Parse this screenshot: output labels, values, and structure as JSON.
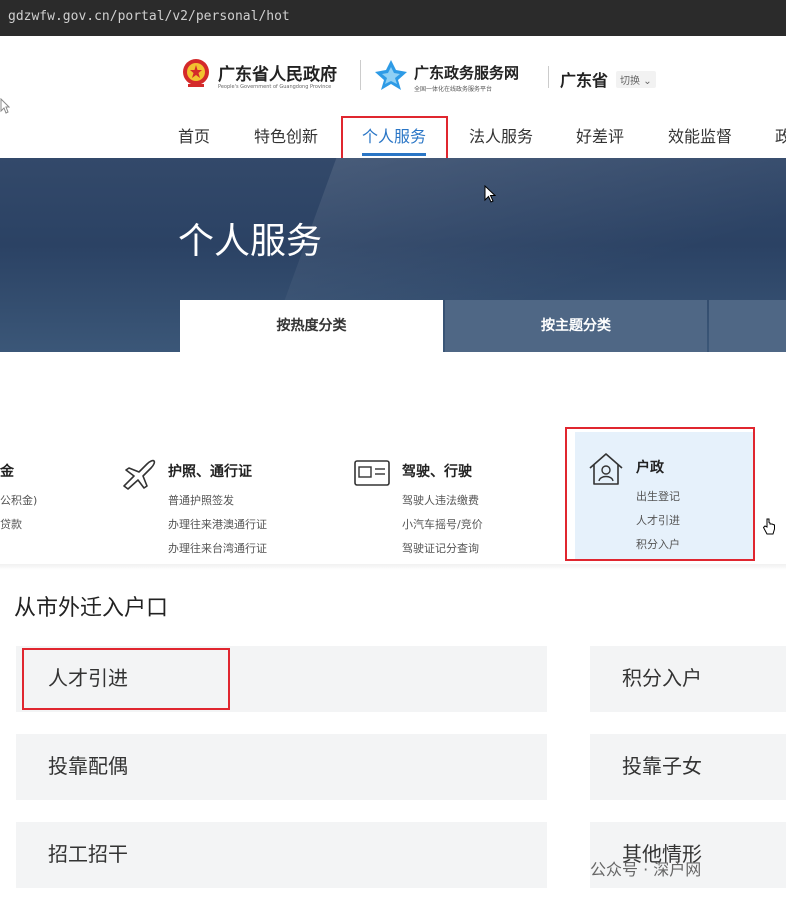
{
  "browser": {
    "url": "gdzwfw.gov.cn/portal/v2/personal/hot"
  },
  "header": {
    "gov_name_cn": "广东省人民政府",
    "gov_name_en": "People's Government of Guangdong Province",
    "service_name": "广东政务服务网",
    "service_subtitle": "全国一体化在线政务服务平台",
    "province": "广东省",
    "switch_label": "切换"
  },
  "nav": {
    "items": [
      "首页",
      "特色创新",
      "个人服务",
      "法人服务",
      "好差评",
      "效能监督",
      "政"
    ],
    "active": "个人服务"
  },
  "banner": {
    "title": "个人服务",
    "tabs": [
      "按热度分类",
      "按主题分类"
    ]
  },
  "categories": [
    {
      "title": "金",
      "items": [
        "公积金)",
        "贷款"
      ]
    },
    {
      "title": "护照、通行证",
      "items": [
        "普通护照签发",
        "办理往来港澳通行证",
        "办理往来台湾通行证"
      ]
    },
    {
      "title": "驾驶、行驶",
      "items": [
        "驾驶人违法缴费",
        "小汽车摇号/竞价",
        "驾驶证记分查询"
      ]
    },
    {
      "title": "户政",
      "items": [
        "出生登记",
        "人才引进",
        "积分入户"
      ]
    }
  ],
  "section": {
    "title": "从市外迁入户口",
    "cards": [
      "人才引进",
      "积分入户",
      "投靠配偶",
      "投靠子女",
      "招工招干",
      "其他情形"
    ]
  },
  "watermark": "公众号 · 深户网",
  "colors": {
    "accent": "#2a76c6",
    "highlight": "#e0262f",
    "banner": "#2b4264"
  }
}
